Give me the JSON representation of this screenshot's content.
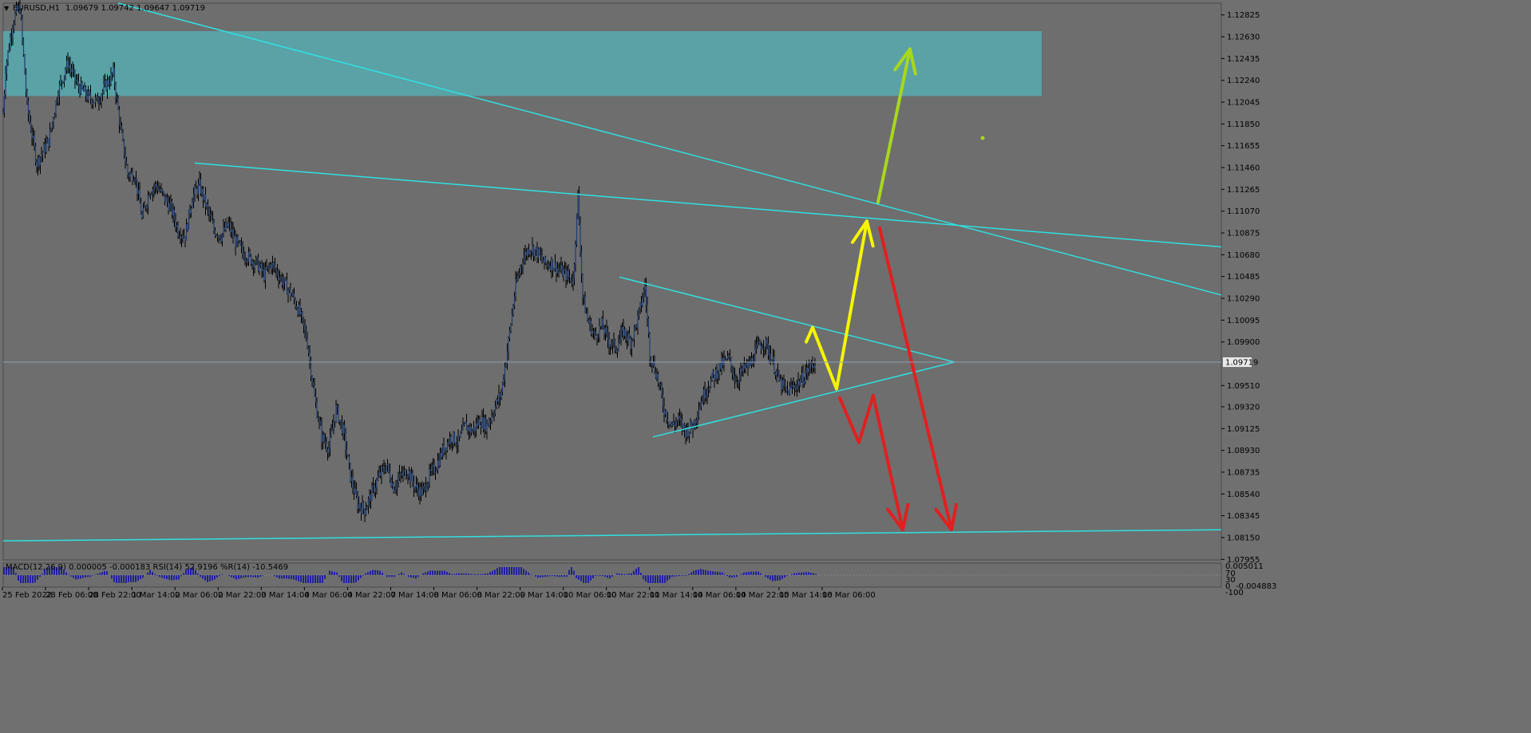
{
  "header": {
    "symbol_text": "EURUSD,H1",
    "ohlc_text": "1.09679 1.09742 1.09647 1.09719"
  },
  "indicator": {
    "label": "MACD(12,26,9) 0.000005 -0.000183  RSI(14) 52.9196  %R(14) -10.5469",
    "right_labels": [
      "0.005011",
      "70",
      "30",
      "0",
      "-0.004883",
      "-100"
    ]
  },
  "colors": {
    "background": "#707070",
    "chart_bg": "#6e6e6e",
    "trendline": "#2fe0e0",
    "zone": "#5aa2a6",
    "candle_body": "#1e3c70",
    "arrow_yellow": "#f5f500",
    "arrow_lime": "#a8d81c",
    "arrow_red": "#e02020",
    "macd_hist": "#2020a0"
  },
  "chart_data": {
    "type": "candlestick",
    "symbol": "EURUSD",
    "timeframe": "H1",
    "last_price": "1.09719",
    "ylim": [
      1.0795,
      1.1293
    ],
    "y_ticks": [
      "1.12825",
      "1.12630",
      "1.12435",
      "1.12240",
      "1.12045",
      "1.11850",
      "1.11655",
      "1.11460",
      "1.11265",
      "1.11070",
      "1.10875",
      "1.10680",
      "1.10485",
      "1.10290",
      "1.10095",
      "1.09900",
      "1.09510",
      "1.09320",
      "1.09125",
      "1.08930",
      "1.08735",
      "1.08540",
      "1.08345",
      "1.08150",
      "1.07955"
    ],
    "x_ticks": [
      "25 Feb 2022",
      "28 Feb 06:00",
      "28 Feb 22:00",
      "1 Mar 14:00",
      "2 Mar 06:00",
      "2 Mar 22:00",
      "3 Mar 14:00",
      "4 Mar 06:00",
      "4 Mar 22:00",
      "7 Mar 14:00",
      "8 Mar 06:00",
      "8 Mar 22:00",
      "9 Mar 14:00",
      "10 Mar 06:00",
      "10 Mar 22:00",
      "11 Mar 14:00",
      "14 Mar 06:00",
      "14 Mar 22:00",
      "15 Mar 14:00",
      "16 Mar 06:00"
    ],
    "price_path": [
      [
        0,
        1.1195
      ],
      [
        2,
        1.1235
      ],
      [
        5,
        1.1255
      ],
      [
        8,
        1.1275
      ],
      [
        11,
        1.1285
      ],
      [
        14,
        1.129
      ],
      [
        20,
        1.12
      ],
      [
        28,
        1.115
      ],
      [
        38,
        1.117
      ],
      [
        46,
        1.1215
      ],
      [
        54,
        1.124
      ],
      [
        62,
        1.122
      ],
      [
        70,
        1.121
      ],
      [
        78,
        1.1205
      ],
      [
        86,
        1.122
      ],
      [
        92,
        1.123
      ],
      [
        98,
        1.118
      ],
      [
        104,
        1.114
      ],
      [
        110,
        1.114
      ],
      [
        116,
        1.11
      ],
      [
        122,
        1.1125
      ],
      [
        128,
        1.113
      ],
      [
        134,
        1.112
      ],
      [
        140,
        1.111
      ],
      [
        146,
        1.109
      ],
      [
        152,
        1.1085
      ],
      [
        158,
        1.112
      ],
      [
        164,
        1.113
      ],
      [
        170,
        1.111
      ],
      [
        176,
        1.109
      ],
      [
        182,
        1.1085
      ],
      [
        188,
        1.1095
      ],
      [
        194,
        1.108
      ],
      [
        200,
        1.107
      ],
      [
        206,
        1.1065
      ],
      [
        212,
        1.106
      ],
      [
        218,
        1.105
      ],
      [
        224,
        1.106
      ],
      [
        230,
        1.105
      ],
      [
        236,
        1.104
      ],
      [
        242,
        1.103
      ],
      [
        248,
        1.1015
      ],
      [
        254,
        1.099
      ],
      [
        260,
        1.094
      ],
      [
        266,
        1.0905
      ],
      [
        272,
        1.0895
      ],
      [
        278,
        1.093
      ],
      [
        284,
        1.091
      ],
      [
        290,
        1.087
      ],
      [
        296,
        1.0845
      ],
      [
        302,
        1.084
      ],
      [
        308,
        1.0855
      ],
      [
        314,
        1.087
      ],
      [
        320,
        1.088
      ],
      [
        326,
        1.086
      ],
      [
        332,
        1.087
      ],
      [
        338,
        1.0875
      ],
      [
        344,
        1.086
      ],
      [
        350,
        1.0855
      ],
      [
        356,
        1.087
      ],
      [
        362,
        1.088
      ],
      [
        368,
        1.0895
      ],
      [
        374,
        1.0905
      ],
      [
        380,
        1.09
      ],
      [
        386,
        1.0915
      ],
      [
        392,
        1.091
      ],
      [
        398,
        1.092
      ],
      [
        404,
        1.0915
      ],
      [
        410,
        1.093
      ],
      [
        416,
        1.0945
      ],
      [
        422,
        1.099
      ],
      [
        428,
        1.104
      ],
      [
        434,
        1.1065
      ],
      [
        440,
        1.1075
      ],
      [
        446,
        1.107
      ],
      [
        452,
        1.106
      ],
      [
        458,
        1.106
      ],
      [
        464,
        1.1055
      ],
      [
        470,
        1.105
      ],
      [
        476,
        1.1045
      ],
      [
        480,
        1.112
      ],
      [
        484,
        1.103
      ],
      [
        488,
        1.101
      ],
      [
        494,
        1.0995
      ],
      [
        500,
        1.1005
      ],
      [
        506,
        1.099
      ],
      [
        512,
        1.0985
      ],
      [
        518,
        1.1
      ],
      [
        524,
        1.099
      ],
      [
        530,
        1.101
      ],
      [
        536,
        1.104
      ],
      [
        540,
        1.098
      ],
      [
        546,
        1.096
      ],
      [
        552,
        1.093
      ],
      [
        558,
        1.0915
      ],
      [
        564,
        1.092
      ],
      [
        570,
        1.091
      ],
      [
        576,
        1.0915
      ],
      [
        582,
        1.0935
      ],
      [
        588,
        1.095
      ],
      [
        594,
        1.096
      ],
      [
        600,
        1.097
      ],
      [
        606,
        1.0975
      ],
      [
        612,
        1.0955
      ],
      [
        618,
        1.0965
      ],
      [
        624,
        1.097
      ],
      [
        630,
        1.0985
      ],
      [
        636,
        1.099
      ],
      [
        642,
        1.0975
      ],
      [
        648,
        1.0955
      ],
      [
        654,
        1.0945
      ],
      [
        660,
        1.095
      ],
      [
        666,
        1.0955
      ],
      [
        672,
        1.0965
      ],
      [
        678,
        1.0972
      ]
    ],
    "trendlines": [
      {
        "from": [
          148,
          1.1293
        ],
        "to": [
          1530,
          1.1032
        ]
      },
      {
        "from": [
          244,
          1.115
        ],
        "to": [
          1530,
          1.1075
        ]
      },
      {
        "from": [
          776,
          1.1048
        ],
        "to": [
          1196,
          1.0972
        ]
      },
      {
        "from": [
          818,
          1.0905
        ],
        "to": [
          1196,
          1.0972
        ]
      },
      {
        "from": [
          4,
          1.0812
        ],
        "to": [
          1530,
          1.0822
        ]
      }
    ],
    "zones": [
      {
        "x_from": 4,
        "x_to": 1305,
        "y_low": 1.121,
        "y_high": 1.1268
      }
    ],
    "arrows": [
      {
        "color": "yellow",
        "points": [
          [
            1010,
            1.099
          ],
          [
            1018,
            1.1003
          ],
          [
            1048,
            1.0948
          ],
          [
            1086,
            1.1098
          ]
        ]
      },
      {
        "color": "lime",
        "points": [
          [
            1100,
            1.1115
          ],
          [
            1140,
            1.1252
          ]
        ]
      },
      {
        "color": "red",
        "points": [
          [
            1052,
            1.094
          ],
          [
            1076,
            1.09
          ],
          [
            1094,
            1.0942
          ],
          [
            1131,
            1.0822
          ]
        ]
      },
      {
        "color": "red",
        "points": [
          [
            1102,
            1.1092
          ],
          [
            1192,
            1.0822
          ]
        ]
      }
    ]
  }
}
